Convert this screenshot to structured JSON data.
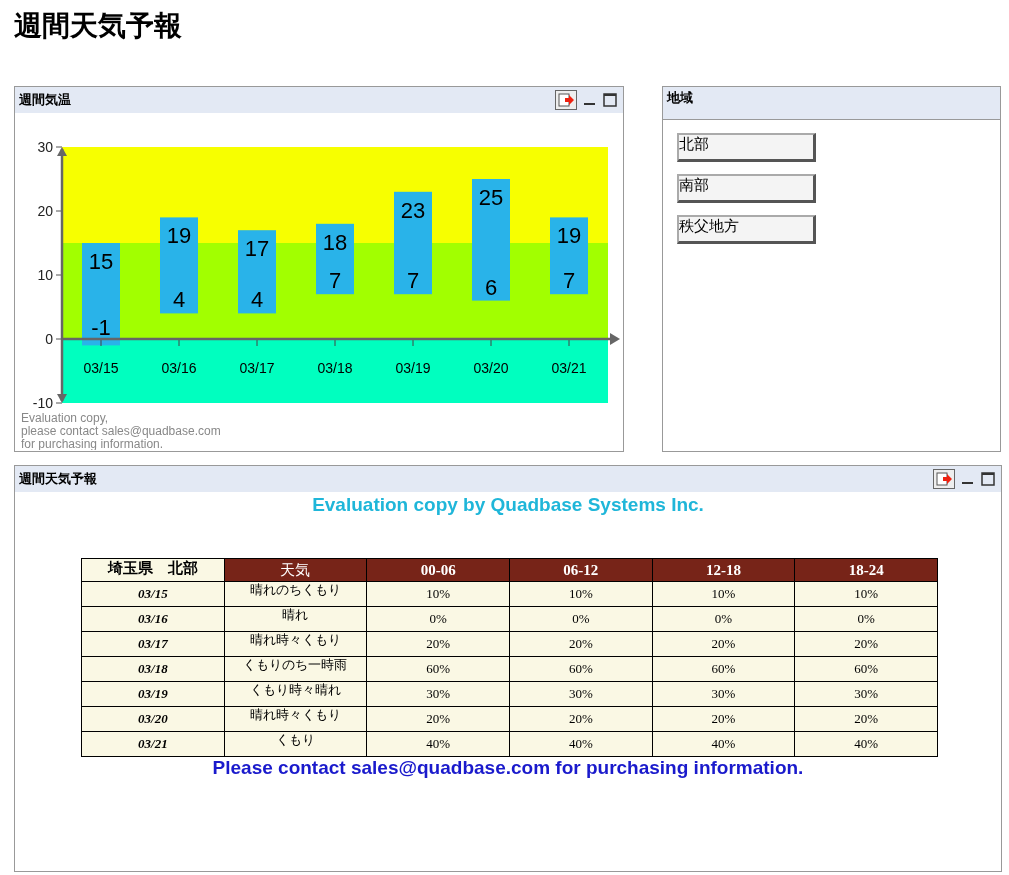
{
  "page_title": "週間天気予報",
  "temperature_panel": {
    "title": "週間気温",
    "chart_data": {
      "type": "candlestick",
      "categories": [
        "03/15",
        "03/16",
        "03/17",
        "03/18",
        "03/19",
        "03/20",
        "03/21"
      ],
      "ohlc": [
        [
          -1,
          15,
          -1,
          15
        ],
        [
          4,
          19,
          4,
          19
        ],
        [
          4,
          17,
          4,
          17
        ],
        [
          7,
          18,
          7,
          18
        ],
        [
          7,
          23,
          7,
          23
        ],
        [
          6,
          25,
          6,
          25
        ],
        [
          7,
          19,
          7,
          19
        ]
      ],
      "color": "#29b3e9",
      "bands": [
        {
          "axis": "y",
          "from": 15,
          "to": 30,
          "color": "#f7ff00"
        },
        {
          "axis": "y",
          "from": 0,
          "to": 15,
          "color": "#a2ff00"
        },
        {
          "axis": "y",
          "from": -10,
          "to": 0,
          "color": "#00ffbf"
        }
      ],
      "ylim": [
        -10,
        30
      ],
      "yticks": [
        -10,
        0,
        10,
        20,
        30
      ],
      "value_labels": [
        [
          "15",
          "-1"
        ],
        [
          "19",
          "4"
        ],
        [
          "17",
          "4"
        ],
        [
          "18",
          "7"
        ],
        [
          "23",
          "7"
        ],
        [
          "25",
          "6"
        ],
        [
          "19",
          "7"
        ]
      ]
    },
    "watermark_lines": [
      "Evaluation copy,",
      "please contact sales@quadbase.com",
      "for purchasing information."
    ]
  },
  "region_panel": {
    "title": "地域",
    "buttons": [
      "北部",
      "南部",
      "秩父地方"
    ]
  },
  "forecast_panel": {
    "title": "週間天気予報",
    "top_notice": "Evaluation copy by Quadbase Systems Inc.",
    "table": {
      "columns": [
        "埼玉県　北部",
        "天気",
        "00-06",
        "06-12",
        "12-18",
        "18-24"
      ],
      "rows": [
        [
          "03/15",
          "晴れのちくもり",
          "10%",
          "10%",
          "10%",
          "10%"
        ],
        [
          "03/16",
          "晴れ",
          "0%",
          "0%",
          "0%",
          "0%"
        ],
        [
          "03/17",
          "晴れ時々くもり",
          "20%",
          "20%",
          "20%",
          "20%"
        ],
        [
          "03/18",
          "くもりのち一時雨",
          "60%",
          "60%",
          "60%",
          "60%"
        ],
        [
          "03/19",
          "くもり時々晴れ",
          "30%",
          "30%",
          "30%",
          "30%"
        ],
        [
          "03/20",
          "晴れ時々くもり",
          "20%",
          "20%",
          "20%",
          "20%"
        ],
        [
          "03/21",
          "くもり",
          "40%",
          "40%",
          "40%",
          "40%"
        ]
      ]
    },
    "bottom_notice": "Please contact sales@quadbase.com for purchasing information."
  }
}
